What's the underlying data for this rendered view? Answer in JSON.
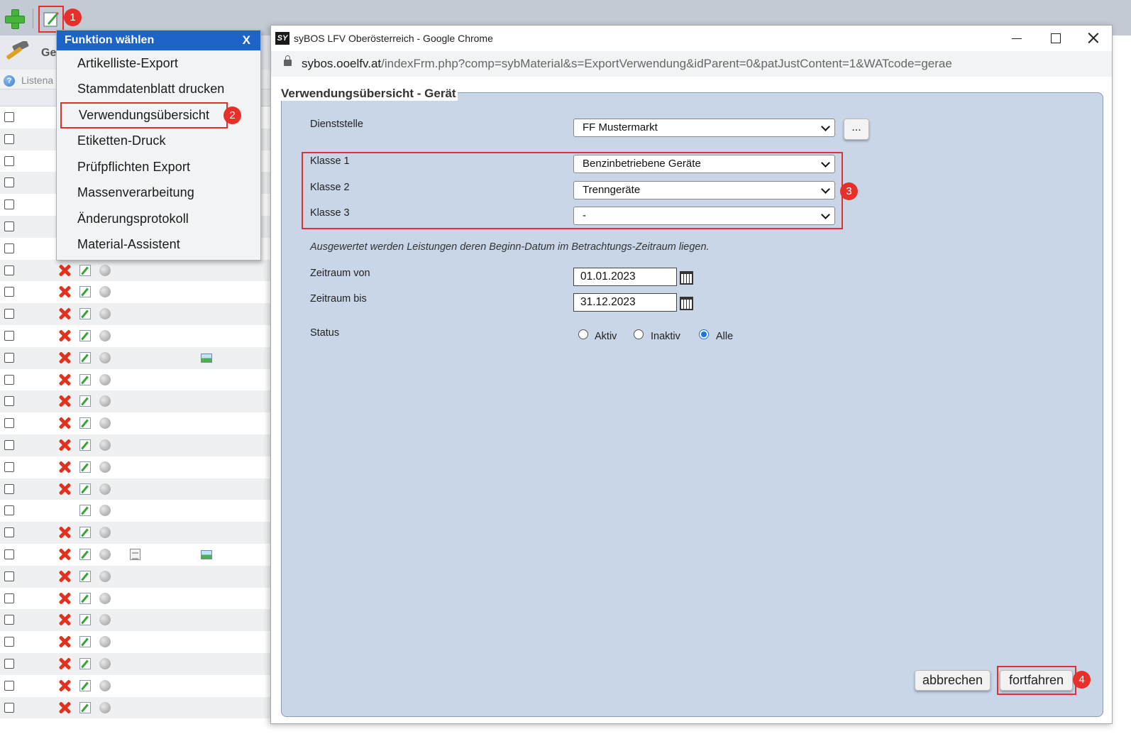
{
  "background": {
    "header_title": "Ge",
    "list_label": "Listena"
  },
  "menu": {
    "title": "Funktion wählen",
    "close_label": "X",
    "items": [
      "Artikelliste-Export",
      "Stammdatenblatt drucken",
      "Verwendungsübersicht",
      "Etiketten-Druck",
      "Prüfpflichten Export",
      "Massenverarbeitung",
      "Änderungsprotokoll",
      "Material-Assistent"
    ]
  },
  "badges": [
    "1",
    "2",
    "3",
    "4"
  ],
  "chrome": {
    "logo": "SY",
    "window_title": "syBOS LFV Oberösterreich - Google Chrome",
    "url_host": "sybos.ooelfv.at",
    "url_path": "/indexFrm.php?comp=sybMaterial&s=ExportVerwendung&idParent=0&patJustContent=1&WATcode=gerae"
  },
  "dialog": {
    "legend": "Verwendungsübersicht - Gerät",
    "dienststelle_label": "Dienststelle",
    "dienststelle_value": "FF Mustermarkt",
    "dots_label": "...",
    "klasse1_label": "Klasse 1",
    "klasse1_value": "Benzinbetriebene Geräte",
    "klasse2_label": "Klasse 2",
    "klasse2_value": "Trenngeräte",
    "klasse3_label": "Klasse 3",
    "klasse3_value": "-",
    "note": "Ausgewertet werden Leistungen deren Beginn-Datum im Betrachtungs-Zeitraum liegen.",
    "von_label": "Zeitraum von",
    "von_value": "01.01.2023",
    "bis_label": "Zeitraum bis",
    "bis_value": "31.12.2023",
    "status_label": "Status",
    "status_options": [
      "Aktiv",
      "Inaktiv",
      "Alle"
    ],
    "status_selected": "Alle",
    "cancel_label": "abbrechen",
    "continue_label": "fortfahren"
  }
}
